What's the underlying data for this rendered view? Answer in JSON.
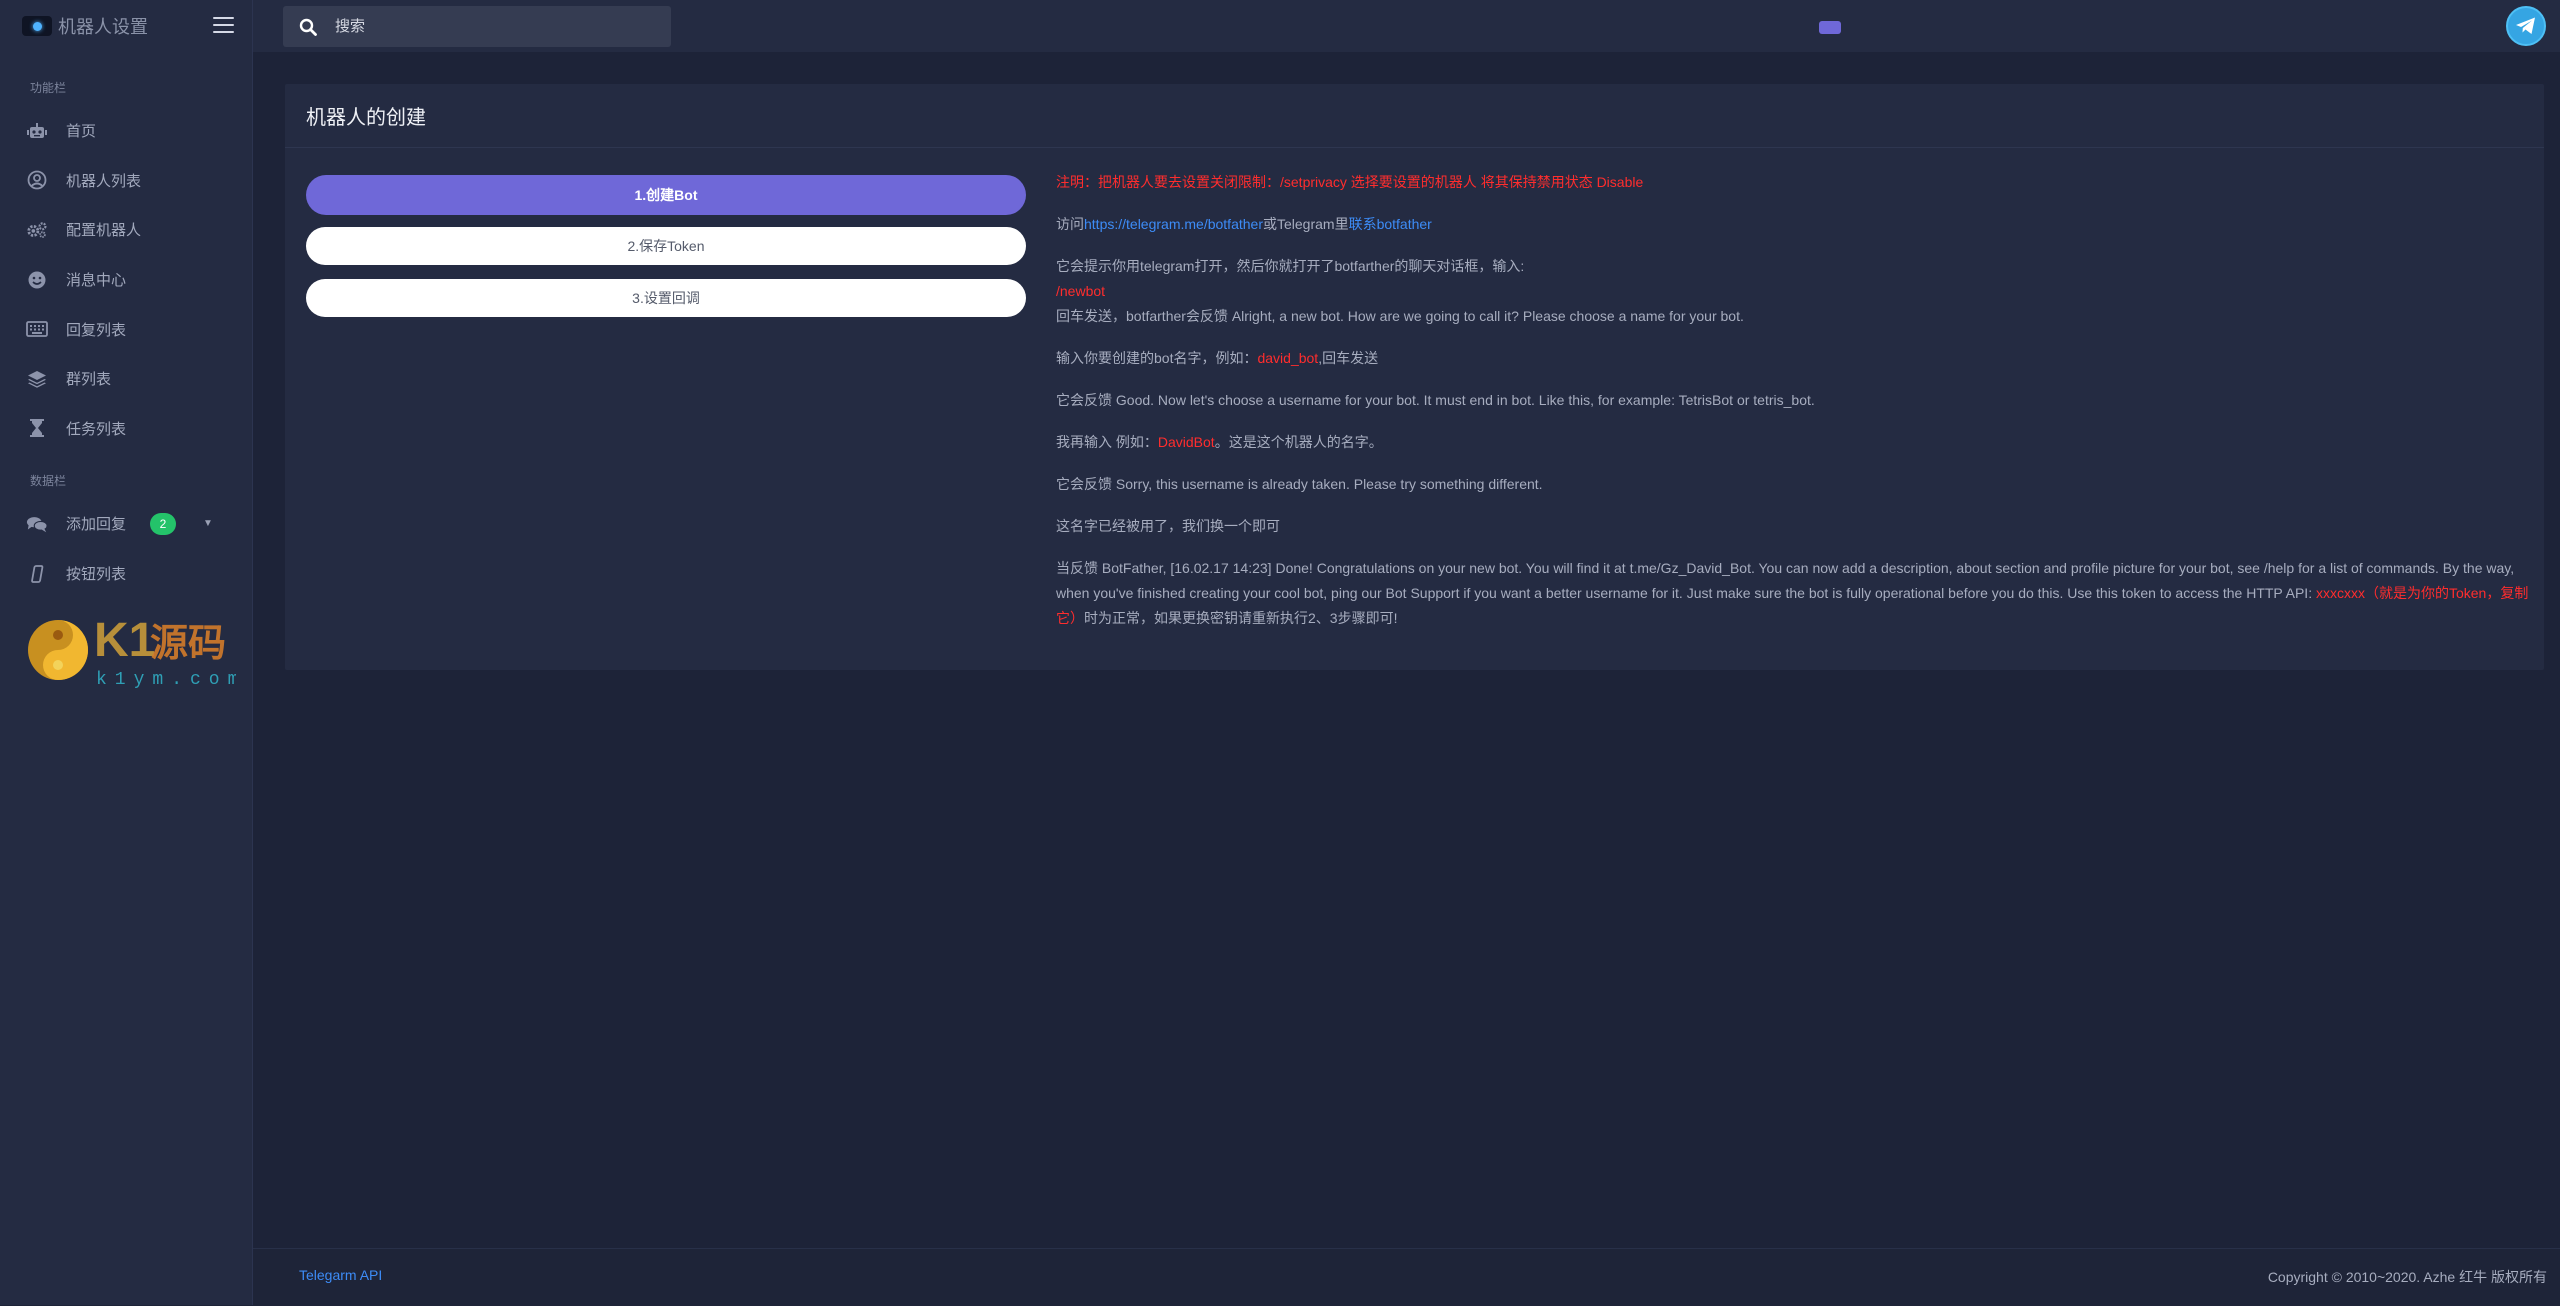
{
  "brand": {
    "title": "机器人设置"
  },
  "sidebar": {
    "section1": "功能栏",
    "items": [
      {
        "label": "首页",
        "icon": "robot-icon"
      },
      {
        "label": "机器人列表",
        "icon": "user-circle-icon"
      },
      {
        "label": "配置机器人",
        "icon": "cogs-icon"
      },
      {
        "label": "消息中心",
        "icon": "smile-icon"
      },
      {
        "label": "回复列表",
        "icon": "keyboard-icon"
      },
      {
        "label": "群列表",
        "icon": "layers-icon"
      },
      {
        "label": "任务列表",
        "icon": "hourglass-icon"
      }
    ],
    "section2": "数据栏",
    "items2": [
      {
        "label": "添加回复",
        "icon": "comments-icon",
        "badge": "2"
      },
      {
        "label": "按钮列表",
        "icon": "mobile-icon"
      }
    ]
  },
  "watermark": {
    "text": "K1源码",
    "url": "k1ym.com"
  },
  "search": {
    "placeholder": "搜索"
  },
  "card": {
    "title": "机器人的创建",
    "steps": [
      "1.创建Bot",
      "2.保存Token",
      "3.设置回调"
    ],
    "notice": "注明：把机器人要去设置关闭限制：/setprivacy 选择要设置的机器人 将其保持禁用状态 Disable",
    "visit_prefix": "访问",
    "visit_link": "https://telegram.me/botfather",
    "visit_mid": "或Telegram里",
    "visit_link2": "联系botfather",
    "p3_line1": "它会提示你用telegram打开，然后你就打开了botfarther的聊天对话框，输入:",
    "p3_cmd": "/newbot",
    "p3_line3": "回车发送，botfarther会反馈 Alright, a new bot. How are we going to call it? Please choose a name for your bot.",
    "p4_pre": "输入你要创建的bot名字，例如：",
    "p4_red": "david_bot",
    "p4_post": ",回车发送",
    "p5": "它会反馈 Good. Now let's choose a username for your bot. It must end in bot. Like this, for example: TetrisBot or tetris_bot.",
    "p6_pre": "我再输入 例如：",
    "p6_red": "DavidBot",
    "p6_post": "。这是这个机器人的名字。",
    "p7": "它会反馈 Sorry, this username is already taken. Please try something different.",
    "p8": "这名字已经被用了，我们换一个即可",
    "p9_pre": "当反馈 BotFather, [16.02.17 14:23] Done! Congratulations on your new bot. You will find it at t.me/Gz_David_Bot. You can now add a description, about section and profile picture for your bot, see /help for a list of commands. By the way, when you've finished creating your cool bot, ping our Bot Support if you want a better username for it. Just make sure the bot is fully operational before you do this. Use this token to access the HTTP API: ",
    "p9_red": "xxxcxxx（就是为你的Token，复制它）",
    "p9_post": "时为正常，如果更换密钥请重新执行2、3步骤即可!"
  },
  "footer": {
    "link": "Telegarm API",
    "copyright": "Copyright © 2010~2020. Azhe 红牛 版权所有"
  },
  "colors": {
    "accent": "#6f68d8",
    "danger": "#ff2d2d",
    "link": "#3d8cf7",
    "badge": "#24c36a"
  }
}
